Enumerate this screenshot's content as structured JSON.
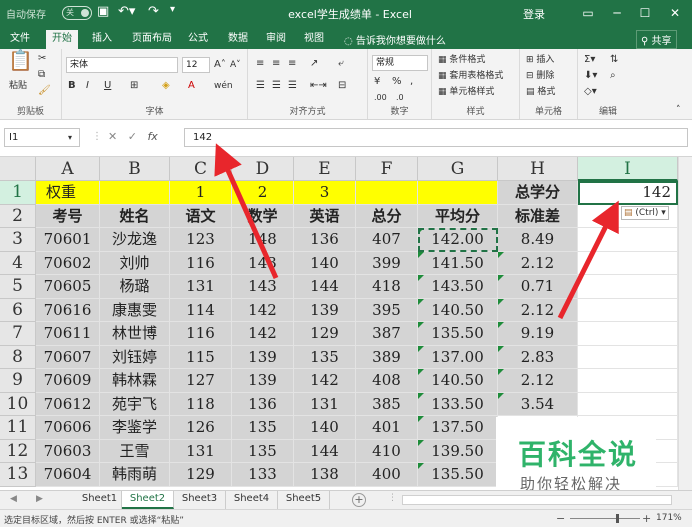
{
  "titlebar": {
    "autosave_label": "自动保存",
    "autosave_state": "关",
    "title": "excel学生成绩单 - Excel",
    "login": "登录"
  },
  "tabs": [
    {
      "label": "文件",
      "active": false
    },
    {
      "label": "开始",
      "active": true
    },
    {
      "label": "插入",
      "active": false
    },
    {
      "label": "页面布局",
      "active": false
    },
    {
      "label": "公式",
      "active": false
    },
    {
      "label": "数据",
      "active": false
    },
    {
      "label": "审阅",
      "active": false
    },
    {
      "label": "视图",
      "active": false
    }
  ],
  "tellme": "告诉我你想要做什么",
  "share": "共享",
  "ribbon": {
    "clipboard": {
      "paste": "粘贴",
      "label": "剪贴板"
    },
    "font": {
      "name": "宋体",
      "size": "12",
      "label": "字体"
    },
    "alignment": {
      "label": "对齐方式"
    },
    "number": {
      "format": "常规",
      "label": "数字"
    },
    "styles": {
      "cond": "条件格式",
      "table": "套用表格格式",
      "cell": "单元格样式",
      "label": "样式"
    },
    "cells": {
      "insert": "插入",
      "delete": "删除",
      "format": "格式",
      "label": "单元格"
    },
    "editing": {
      "label": "编辑"
    }
  },
  "formula_bar": {
    "name_box": "I1",
    "value": "142",
    "fx": "fx"
  },
  "columns": [
    "A",
    "B",
    "C",
    "D",
    "E",
    "F",
    "G",
    "H",
    "I"
  ],
  "rows": [
    "1",
    "2",
    "3",
    "4",
    "5",
    "6",
    "7",
    "8",
    "9",
    "10",
    "11",
    "12",
    "13"
  ],
  "row1": {
    "a": "权重",
    "c": "1",
    "d": "2",
    "e": "3",
    "h": "总学分",
    "i": "142"
  },
  "headers": [
    "考号",
    "姓名",
    "语文",
    "数学",
    "英语",
    "总分",
    "平均分",
    "标准差"
  ],
  "table": [
    [
      "70601",
      "沙龙逸",
      "123",
      "148",
      "136",
      "407",
      "142.00",
      "8.49"
    ],
    [
      "70602",
      "刘帅",
      "116",
      "143",
      "140",
      "399",
      "141.50",
      "2.12"
    ],
    [
      "70605",
      "杨璐",
      "131",
      "143",
      "144",
      "418",
      "143.50",
      "0.71"
    ],
    [
      "70616",
      "康惠雯",
      "114",
      "142",
      "139",
      "395",
      "140.50",
      "2.12"
    ],
    [
      "70611",
      "林世博",
      "116",
      "142",
      "129",
      "387",
      "135.50",
      "9.19"
    ],
    [
      "70607",
      "刘钰婷",
      "115",
      "139",
      "135",
      "389",
      "137.00",
      "2.83"
    ],
    [
      "70609",
      "韩林霖",
      "127",
      "139",
      "142",
      "408",
      "140.50",
      "2.12"
    ],
    [
      "70612",
      "苑宇飞",
      "118",
      "136",
      "131",
      "385",
      "133.50",
      "3.54"
    ],
    [
      "70606",
      "李鉴学",
      "126",
      "135",
      "140",
      "401",
      "137.50",
      ""
    ],
    [
      "70603",
      "王雪",
      "131",
      "135",
      "144",
      "410",
      "139.50",
      ""
    ],
    [
      "70604",
      "韩雨萌",
      "129",
      "133",
      "138",
      "400",
      "135.50",
      ""
    ]
  ],
  "paste_options": "(Ctrl)",
  "watermark": {
    "title": "百科全说",
    "subtitle": "助你轻松解决"
  },
  "sheets": [
    {
      "label": "Sheet1",
      "active": false
    },
    {
      "label": "Sheet2",
      "active": true
    },
    {
      "label": "Sheet3",
      "active": false
    },
    {
      "label": "Sheet4",
      "active": false
    },
    {
      "label": "Sheet5",
      "active": false
    }
  ],
  "status": {
    "message": "选定目标区域，然后按 ENTER 或选择“粘贴”",
    "zoom": "171%"
  },
  "colors": {
    "accent": "#217346",
    "highlight": "#ffff00",
    "arrow": "#e8262c",
    "watermark": "#2fb36a"
  }
}
